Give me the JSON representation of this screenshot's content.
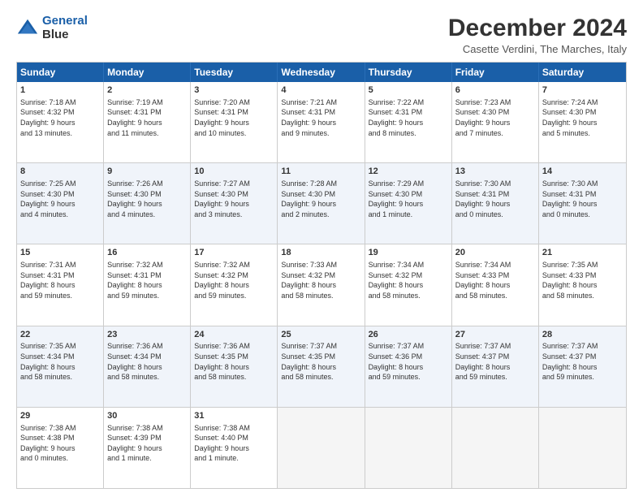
{
  "logo": {
    "line1": "General",
    "line2": "Blue"
  },
  "title": "December 2024",
  "subtitle": "Casette Verdini, The Marches, Italy",
  "days_of_week": [
    "Sunday",
    "Monday",
    "Tuesday",
    "Wednesday",
    "Thursday",
    "Friday",
    "Saturday"
  ],
  "weeks": [
    [
      {
        "day": "1",
        "info": "Sunrise: 7:18 AM\nSunset: 4:32 PM\nDaylight: 9 hours\nand 13 minutes."
      },
      {
        "day": "2",
        "info": "Sunrise: 7:19 AM\nSunset: 4:31 PM\nDaylight: 9 hours\nand 11 minutes."
      },
      {
        "day": "3",
        "info": "Sunrise: 7:20 AM\nSunset: 4:31 PM\nDaylight: 9 hours\nand 10 minutes."
      },
      {
        "day": "4",
        "info": "Sunrise: 7:21 AM\nSunset: 4:31 PM\nDaylight: 9 hours\nand 9 minutes."
      },
      {
        "day": "5",
        "info": "Sunrise: 7:22 AM\nSunset: 4:31 PM\nDaylight: 9 hours\nand 8 minutes."
      },
      {
        "day": "6",
        "info": "Sunrise: 7:23 AM\nSunset: 4:30 PM\nDaylight: 9 hours\nand 7 minutes."
      },
      {
        "day": "7",
        "info": "Sunrise: 7:24 AM\nSunset: 4:30 PM\nDaylight: 9 hours\nand 5 minutes."
      }
    ],
    [
      {
        "day": "8",
        "info": "Sunrise: 7:25 AM\nSunset: 4:30 PM\nDaylight: 9 hours\nand 4 minutes."
      },
      {
        "day": "9",
        "info": "Sunrise: 7:26 AM\nSunset: 4:30 PM\nDaylight: 9 hours\nand 4 minutes."
      },
      {
        "day": "10",
        "info": "Sunrise: 7:27 AM\nSunset: 4:30 PM\nDaylight: 9 hours\nand 3 minutes."
      },
      {
        "day": "11",
        "info": "Sunrise: 7:28 AM\nSunset: 4:30 PM\nDaylight: 9 hours\nand 2 minutes."
      },
      {
        "day": "12",
        "info": "Sunrise: 7:29 AM\nSunset: 4:30 PM\nDaylight: 9 hours\nand 1 minute."
      },
      {
        "day": "13",
        "info": "Sunrise: 7:30 AM\nSunset: 4:31 PM\nDaylight: 9 hours\nand 0 minutes."
      },
      {
        "day": "14",
        "info": "Sunrise: 7:30 AM\nSunset: 4:31 PM\nDaylight: 9 hours\nand 0 minutes."
      }
    ],
    [
      {
        "day": "15",
        "info": "Sunrise: 7:31 AM\nSunset: 4:31 PM\nDaylight: 8 hours\nand 59 minutes."
      },
      {
        "day": "16",
        "info": "Sunrise: 7:32 AM\nSunset: 4:31 PM\nDaylight: 8 hours\nand 59 minutes."
      },
      {
        "day": "17",
        "info": "Sunrise: 7:32 AM\nSunset: 4:32 PM\nDaylight: 8 hours\nand 59 minutes."
      },
      {
        "day": "18",
        "info": "Sunrise: 7:33 AM\nSunset: 4:32 PM\nDaylight: 8 hours\nand 58 minutes."
      },
      {
        "day": "19",
        "info": "Sunrise: 7:34 AM\nSunset: 4:32 PM\nDaylight: 8 hours\nand 58 minutes."
      },
      {
        "day": "20",
        "info": "Sunrise: 7:34 AM\nSunset: 4:33 PM\nDaylight: 8 hours\nand 58 minutes."
      },
      {
        "day": "21",
        "info": "Sunrise: 7:35 AM\nSunset: 4:33 PM\nDaylight: 8 hours\nand 58 minutes."
      }
    ],
    [
      {
        "day": "22",
        "info": "Sunrise: 7:35 AM\nSunset: 4:34 PM\nDaylight: 8 hours\nand 58 minutes."
      },
      {
        "day": "23",
        "info": "Sunrise: 7:36 AM\nSunset: 4:34 PM\nDaylight: 8 hours\nand 58 minutes."
      },
      {
        "day": "24",
        "info": "Sunrise: 7:36 AM\nSunset: 4:35 PM\nDaylight: 8 hours\nand 58 minutes."
      },
      {
        "day": "25",
        "info": "Sunrise: 7:37 AM\nSunset: 4:35 PM\nDaylight: 8 hours\nand 58 minutes."
      },
      {
        "day": "26",
        "info": "Sunrise: 7:37 AM\nSunset: 4:36 PM\nDaylight: 8 hours\nand 59 minutes."
      },
      {
        "day": "27",
        "info": "Sunrise: 7:37 AM\nSunset: 4:37 PM\nDaylight: 8 hours\nand 59 minutes."
      },
      {
        "day": "28",
        "info": "Sunrise: 7:37 AM\nSunset: 4:37 PM\nDaylight: 8 hours\nand 59 minutes."
      }
    ],
    [
      {
        "day": "29",
        "info": "Sunrise: 7:38 AM\nSunset: 4:38 PM\nDaylight: 9 hours\nand 0 minutes."
      },
      {
        "day": "30",
        "info": "Sunrise: 7:38 AM\nSunset: 4:39 PM\nDaylight: 9 hours\nand 1 minute."
      },
      {
        "day": "31",
        "info": "Sunrise: 7:38 AM\nSunset: 4:40 PM\nDaylight: 9 hours\nand 1 minute."
      },
      {
        "day": "",
        "info": ""
      },
      {
        "day": "",
        "info": ""
      },
      {
        "day": "",
        "info": ""
      },
      {
        "day": "",
        "info": ""
      }
    ]
  ]
}
